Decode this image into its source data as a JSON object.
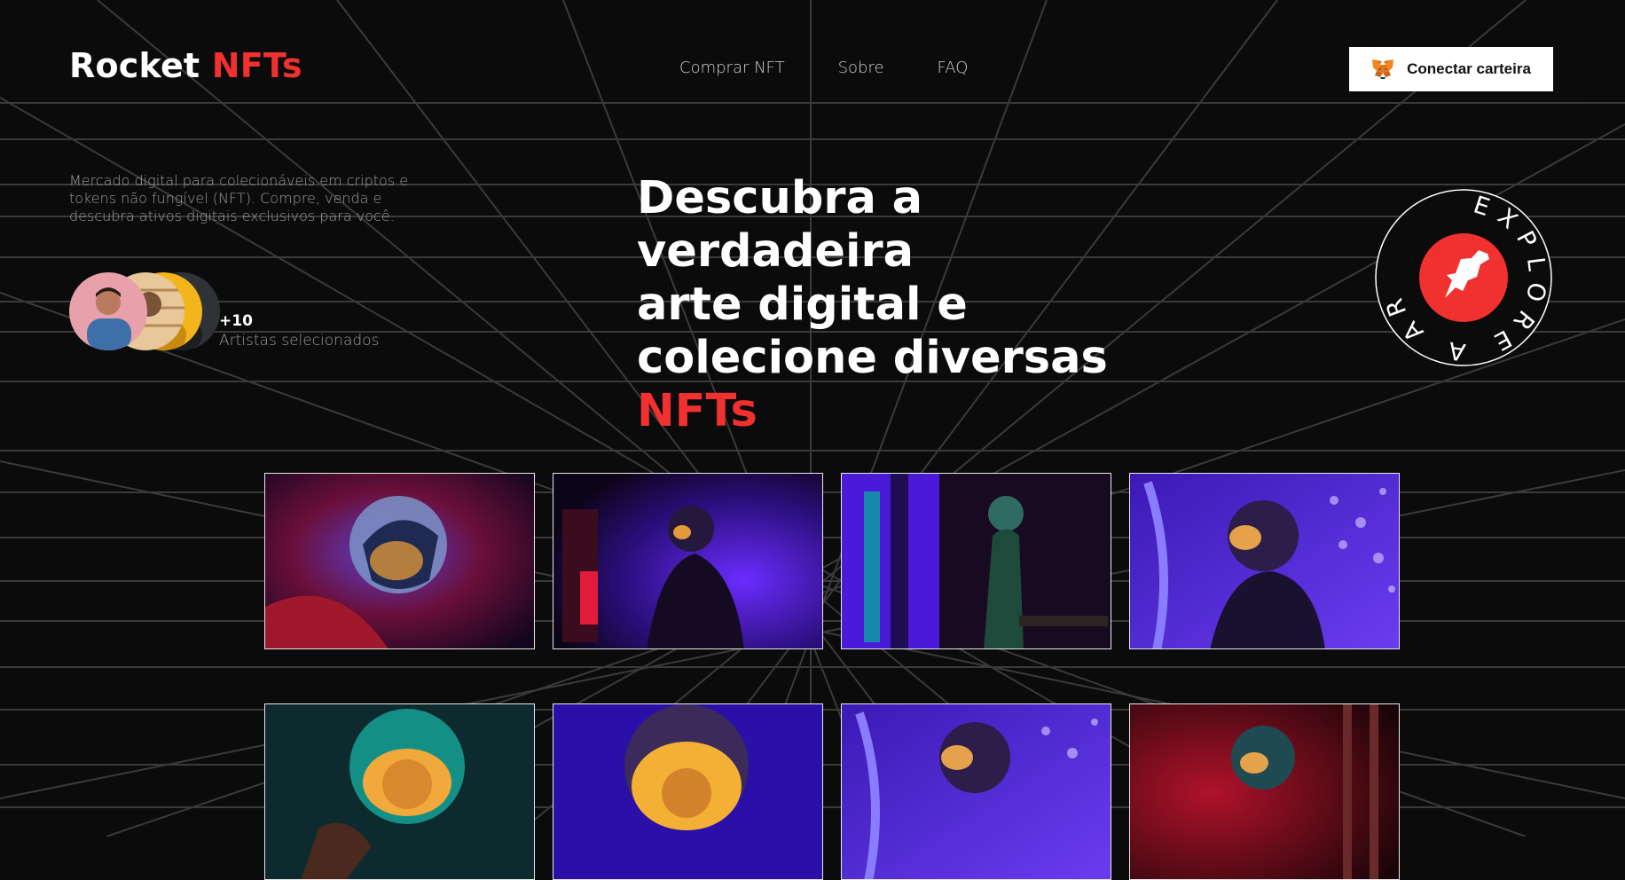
{
  "header": {
    "logo_main": "Rocket",
    "logo_accent": "NFTs",
    "nav": [
      "Comprar NFT",
      "Sobre",
      "FAQ"
    ],
    "wallet_button": "Conectar carteira"
  },
  "hero": {
    "description": "Mercado digital para colecionáveis em criptos e tokens não fungível (NFT). Compre, venda e descubra ativos digitais exclusivos para você.",
    "artists_count": "+10",
    "artists_label": "Artistas selecionados",
    "headline_line1": "Descubra a verdadeira",
    "headline_line2": "arte digital e",
    "headline_line3": "colecione diversas",
    "headline_accent": "NFTs",
    "badge_text": "EXPLORE A ARTE"
  },
  "colors": {
    "accent": "#f0312f",
    "background": "#0b0b0c",
    "button_bg": "#ffffff"
  }
}
